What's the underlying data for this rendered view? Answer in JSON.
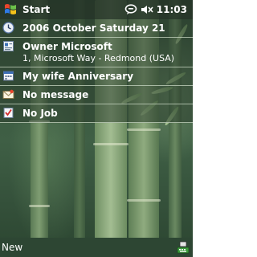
{
  "titlebar": {
    "start_label": "Start",
    "time": "11:03",
    "status_icons": [
      "start-flag-icon",
      "notification-bubble-icon",
      "speaker-mute-icon"
    ]
  },
  "today": {
    "date": "2006 October Saturday 21",
    "owner_name": "Owner Microsoft",
    "owner_address": "1, Microsoft Way - Redmond (USA)",
    "appointment": "My wife Anniversary",
    "messages": "No message",
    "tasks": "No Job"
  },
  "menubar": {
    "left_softkey": "New",
    "input_icon": "keyboard-sip-icon"
  },
  "colors": {
    "titlebar_bg": "#263428",
    "menubar_bg": "#2d4633",
    "divider": "#c8d7c3",
    "text": "#ffffff"
  }
}
